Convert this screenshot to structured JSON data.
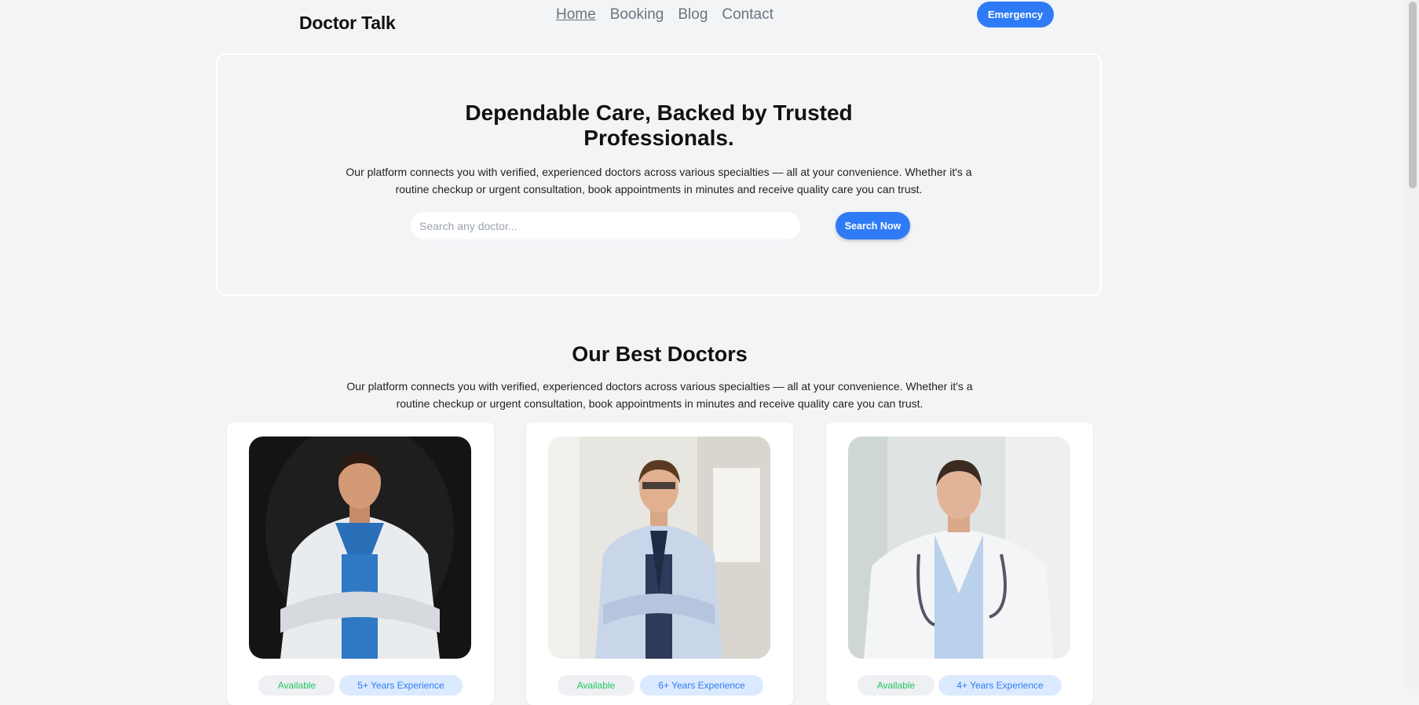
{
  "nav": {
    "brand": "Doctor Talk",
    "links": [
      "Home",
      "Booking",
      "Blog",
      "Contact"
    ],
    "emergency": "Emergency"
  },
  "hero": {
    "title_line1": "Dependable Care, Backed by Trusted",
    "title_line2": "Professionals.",
    "description_line1": "Our platform connects you with verified, experienced doctors across various specialties — all at your convenience. Whether it's a",
    "description_line2": "routine checkup or urgent consultation, book appointments in minutes and receive quality care you can trust.",
    "search_placeholder": "Search any doctor...",
    "search_button": "Search Now"
  },
  "section": {
    "title": "Our Best Doctors",
    "description_line1": "Our platform connects you with verified, experienced doctors across various specialties — all at your convenience. Whether it's a",
    "description_line2": "routine checkup or urgent consultation, book appointments in minutes and receive quality care you can trust."
  },
  "doctors": [
    {
      "status": "Available",
      "experience": "5+ Years Experience"
    },
    {
      "status": "Available",
      "experience": "6+ Years Experience"
    },
    {
      "status": "Available",
      "experience": "4+ Years Experience"
    }
  ],
  "colors": {
    "accent": "#2f7bf6",
    "available": "#22c55e",
    "background": "#f3f4f6"
  }
}
